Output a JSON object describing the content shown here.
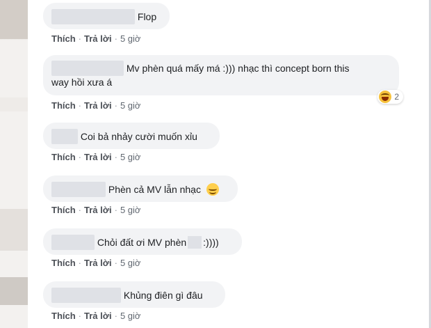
{
  "action": {
    "like": "Thích",
    "reply": "Trả lời",
    "sep": "·"
  },
  "comments": [
    {
      "text": "Flop",
      "time": "5 giờ"
    },
    {
      "text_a": "Mv phèn quá mấy má :))) nhạc thì concept born this",
      "text_b": "way hồi xưa á",
      "time": "5 giờ",
      "reaction": {
        "icon": "haha-emoji-icon",
        "count": "2"
      }
    },
    {
      "text": "Coi bả nhảy cười muốn xỉu",
      "time": "5 giờ"
    },
    {
      "text": "Phèn cả MV lẫn nhạc",
      "time": "5 giờ",
      "emoji": "smiling-emoji-icon"
    },
    {
      "text_a": "Chỏi đất ơi MV phèn",
      "text_b": ":))))",
      "time": "5 giờ"
    },
    {
      "text": "Khủng điên gì đâu",
      "time": "5 giờ"
    }
  ]
}
